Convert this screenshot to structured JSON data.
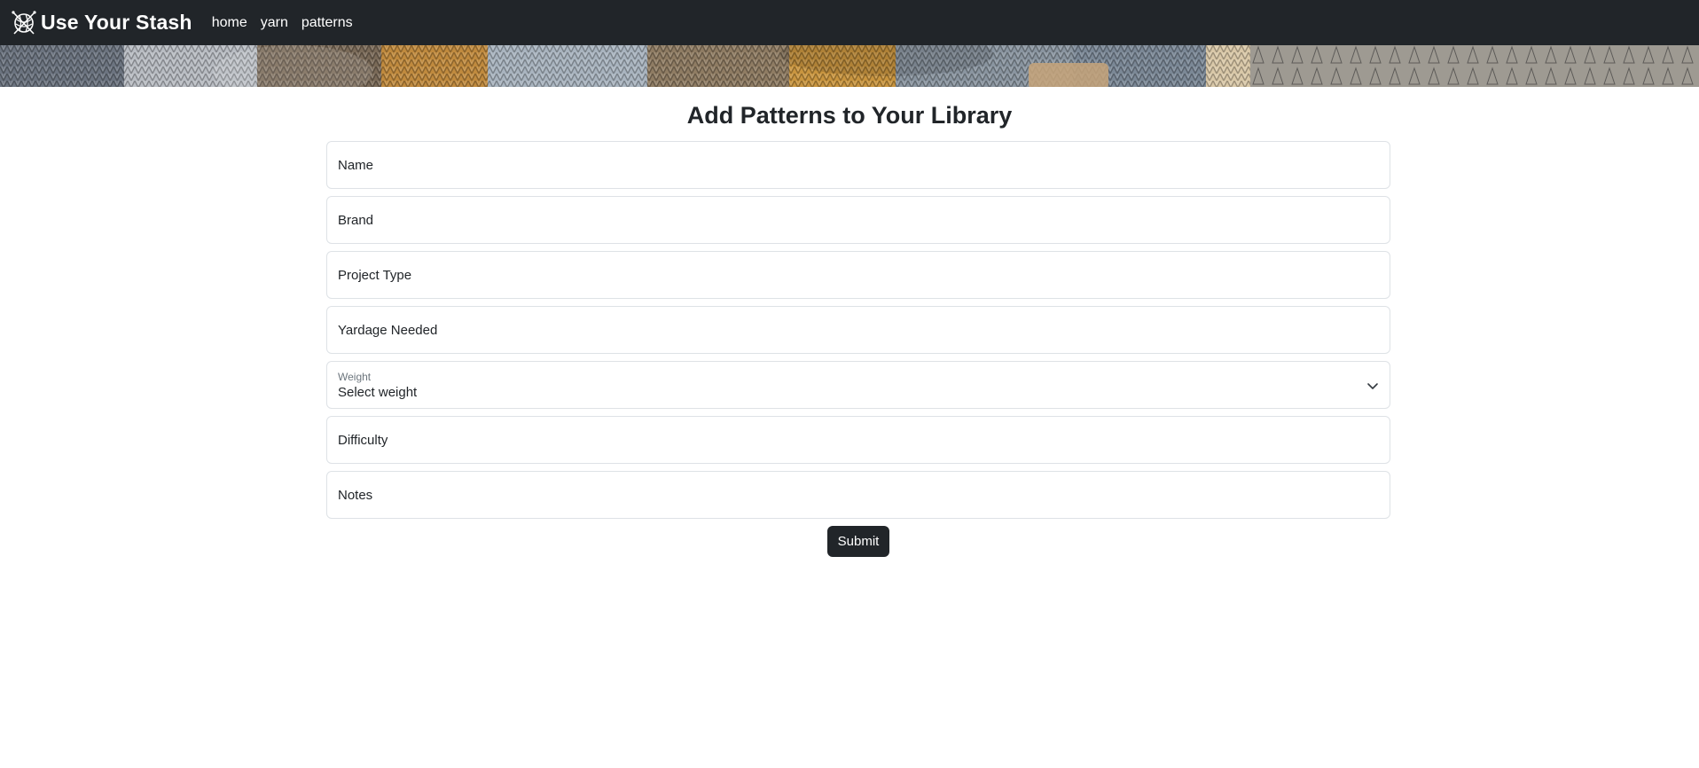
{
  "navbar": {
    "brand": "Use Your Stash",
    "brand_icon": "yarn-ball-icon",
    "links": [
      {
        "label": "home"
      },
      {
        "label": "yarn"
      },
      {
        "label": "patterns"
      }
    ]
  },
  "banner": {
    "image": "knitted-yarn-banner",
    "colors": [
      "#6c7480",
      "#c08a3e",
      "#a9b4bf",
      "#8a95a0",
      "#d9c8a8",
      "#9e9a92"
    ]
  },
  "main": {
    "title": "Add Patterns to Your Library",
    "fields": {
      "name": {
        "placeholder": "Name",
        "value": ""
      },
      "brand": {
        "placeholder": "Brand",
        "value": ""
      },
      "project_type": {
        "placeholder": "Project Type",
        "value": ""
      },
      "yardage": {
        "placeholder": "Yardage Needed",
        "value": ""
      },
      "weight": {
        "label": "Weight",
        "selected": "Select weight",
        "icon": "chevron-down-icon"
      },
      "difficulty": {
        "placeholder": "Difficulty",
        "value": ""
      },
      "notes": {
        "placeholder": "Notes",
        "value": ""
      }
    },
    "submit_label": "Submit"
  },
  "colors": {
    "navbar_bg": "#212529",
    "button_bg": "#212529",
    "border": "#dee2e6",
    "text": "#212529"
  }
}
